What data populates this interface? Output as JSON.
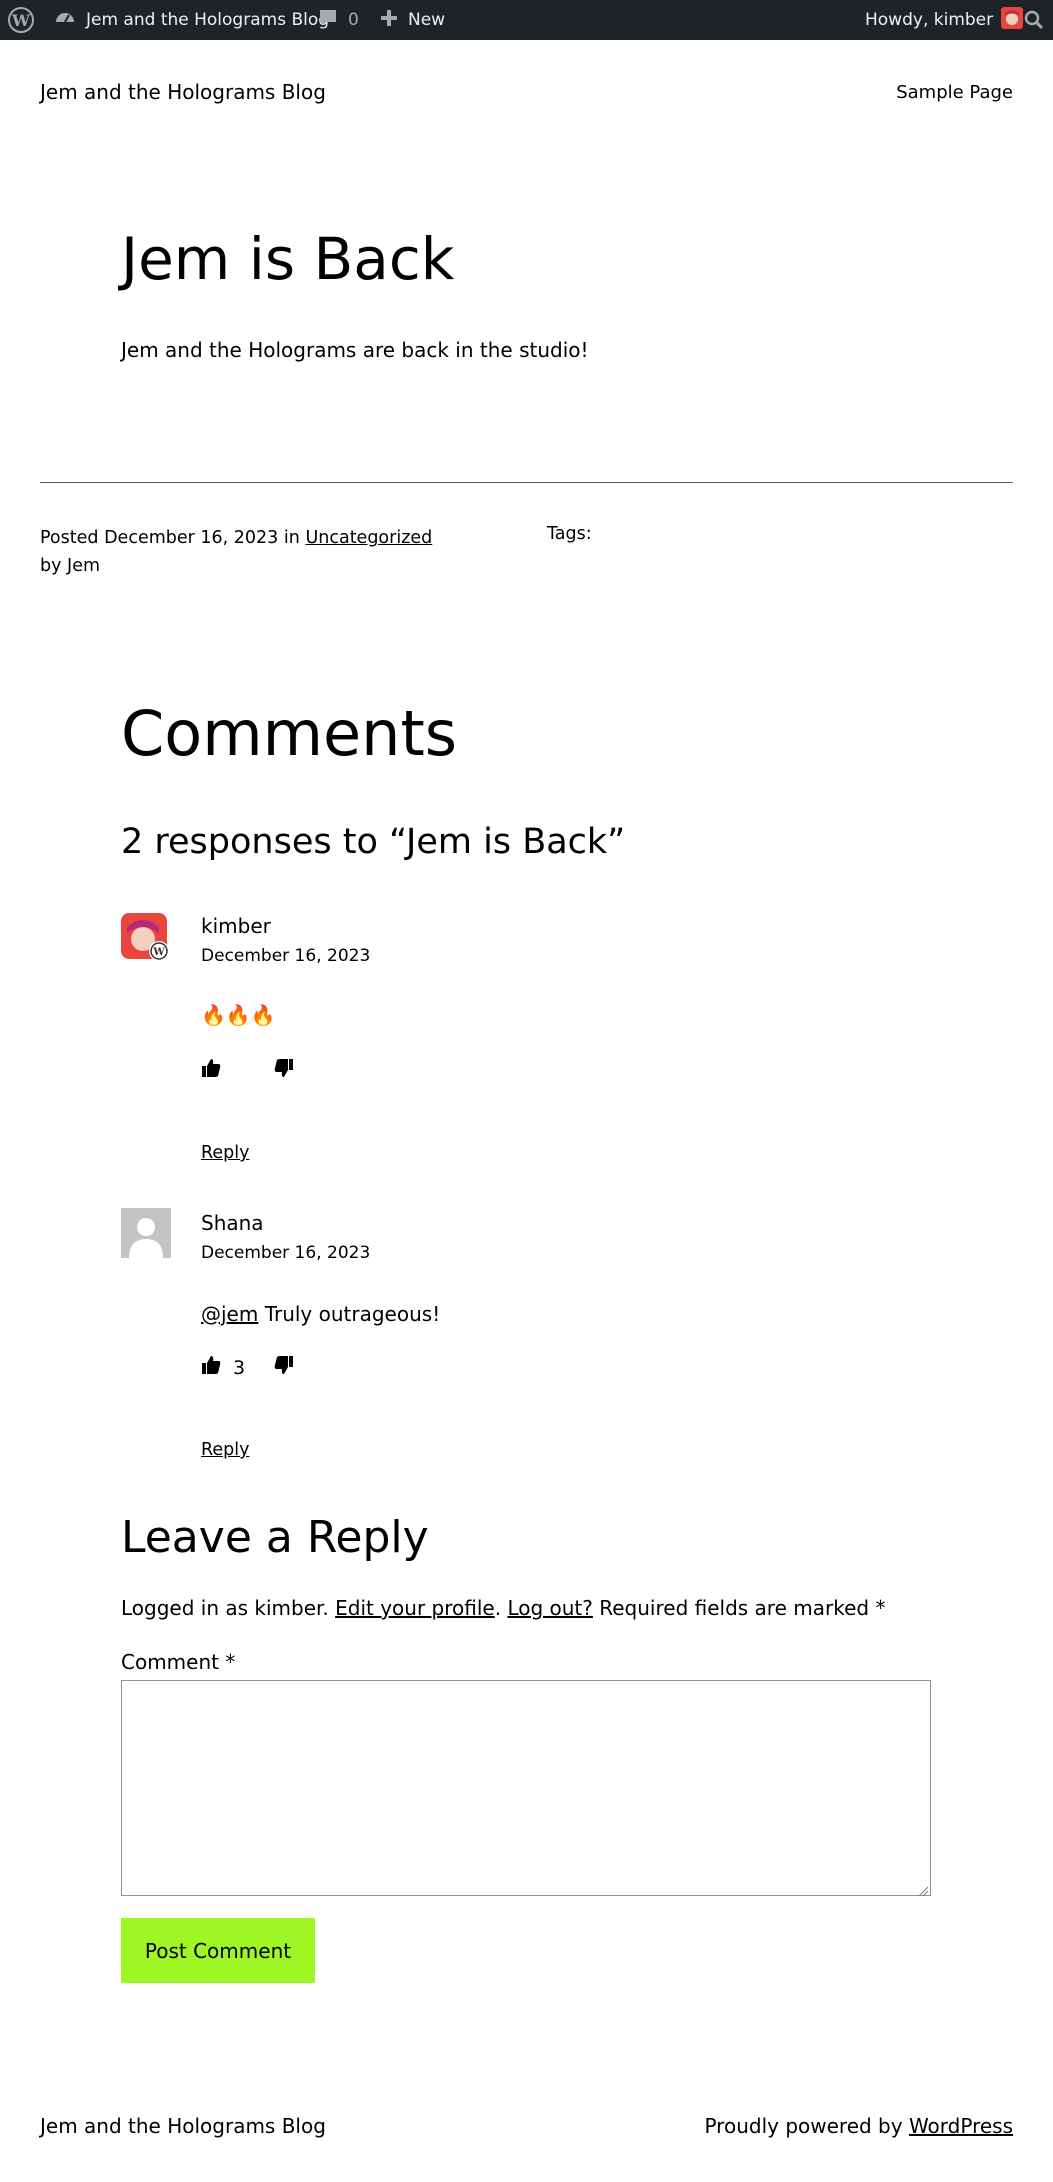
{
  "admin_bar": {
    "site_name": "Jem and the Holograms Blog",
    "comment_count": "0",
    "new_label": "New",
    "howdy": "Howdy, kimber"
  },
  "header": {
    "site_title": "Jem and the Holograms Blog",
    "nav_item": "Sample Page"
  },
  "post": {
    "title": "Jem is Back",
    "body": "Jem and the Holograms are back in the studio!",
    "meta": {
      "posted_prefix": "Posted",
      "date": "December 16, 2023",
      "in_word": "in",
      "category": "Uncategorized",
      "by_line": "by Jem",
      "tags_label": "Tags:"
    }
  },
  "comments": {
    "heading": "Comments",
    "responses_heading": "2 responses to “Jem is Back”",
    "list": [
      {
        "author": "kimber",
        "date": "December 16, 2023",
        "text": "🔥🔥🔥",
        "likes": "",
        "reply_label": "Reply"
      },
      {
        "author": "Shana",
        "date": "December 16, 2023",
        "mention": "@jem",
        "text": " Truly outrageous!",
        "likes": "3",
        "reply_label": "Reply"
      }
    ]
  },
  "reply_form": {
    "heading": "Leave a Reply",
    "logged_in_prefix": "Logged in as kimber. ",
    "edit_profile": "Edit your profile",
    "period": ".",
    "logout": "Log out?",
    "required_note": " Required fields are marked ",
    "required_star": "*",
    "comment_label": "Comment *",
    "comment_value": "",
    "submit_label": "Post Comment"
  },
  "footer": {
    "site_title": "Jem and the Holograms Blog",
    "powered_prefix": "Proudly powered by ",
    "powered_link": "WordPress"
  },
  "colors": {
    "admin_bar_bg": "#1d2327",
    "button_bg": "#9ef725",
    "avatar_red": "#e8453c",
    "default_avatar": "#c4c4c4"
  }
}
